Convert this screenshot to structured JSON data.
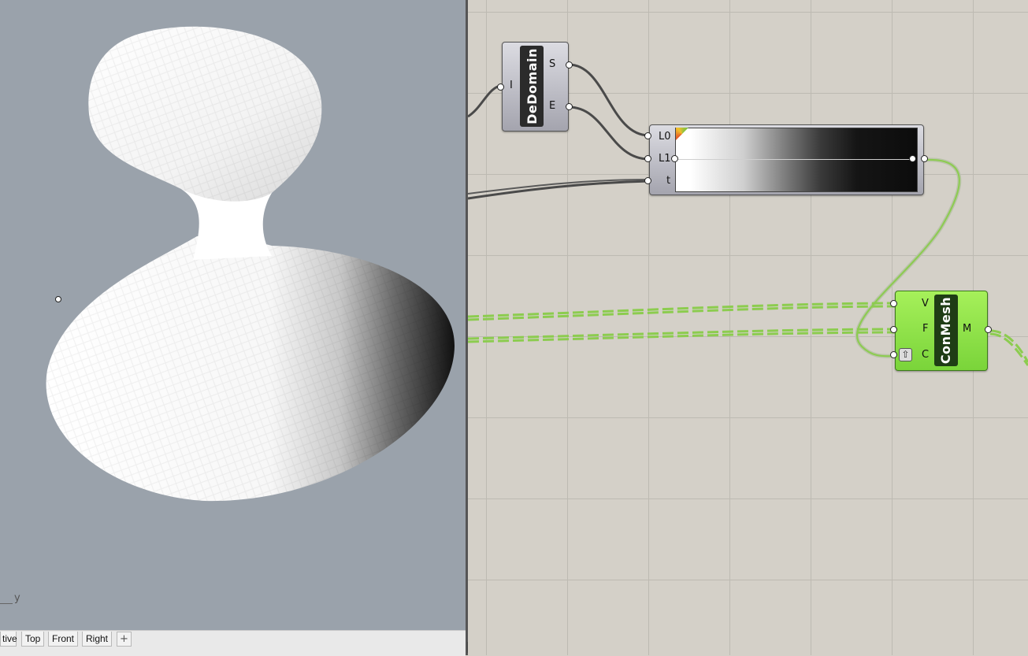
{
  "viewport": {
    "axis_label": "y",
    "tabs": [
      "tive",
      "Top",
      "Front",
      "Right"
    ],
    "add_tab_label": "+"
  },
  "components": {
    "dedomain": {
      "nickname": "DeDomain",
      "input": "I",
      "outputs": [
        "S",
        "E"
      ]
    },
    "gradient": {
      "inputs": [
        "L0",
        "L1",
        "t"
      ]
    },
    "conmesh": {
      "nickname": "ConMesh",
      "inputs": [
        "V",
        "F",
        "C"
      ],
      "output": "M"
    }
  },
  "colors": {
    "viewport_bg": "#9aa2ab",
    "canvas_bg": "#d4d0c8",
    "wire_data": "#4a4a4a",
    "wire_tree": "#8ccc4f",
    "conmesh_green": "#8ee04a"
  }
}
